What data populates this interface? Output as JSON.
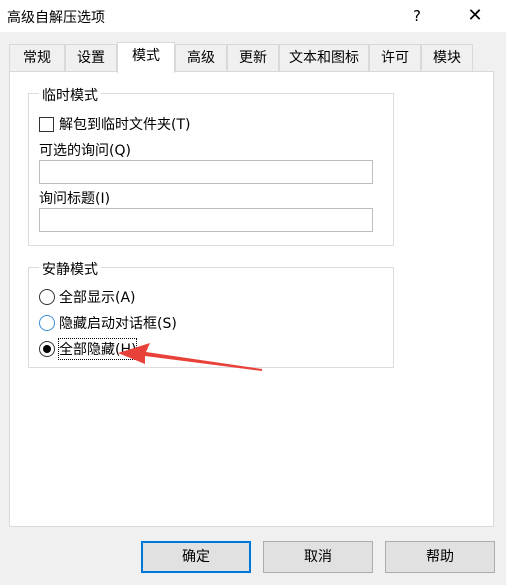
{
  "window": {
    "title": "高级自解压选项",
    "help_label": "?",
    "close_label": "✕"
  },
  "tabs": [
    {
      "label": "常规"
    },
    {
      "label": "设置"
    },
    {
      "label": "模式"
    },
    {
      "label": "高级"
    },
    {
      "label": "更新"
    },
    {
      "label": "文本和图标"
    },
    {
      "label": "许可"
    },
    {
      "label": "模块"
    }
  ],
  "temp_mode": {
    "title": "临时模式",
    "unpack_checkbox": {
      "label": "解包到临时文件夹(T)",
      "checked": false
    },
    "optional_query_label": "可选的询问(Q)",
    "optional_query_value": "",
    "query_title_label": "询问标题(I)",
    "query_title_value": ""
  },
  "silent_mode": {
    "title": "安静模式",
    "options": [
      {
        "label": "全部显示(A)",
        "checked": false
      },
      {
        "label": "隐藏启动对话框(S)",
        "checked": false
      },
      {
        "label": "全部隐藏(H)",
        "checked": true
      }
    ]
  },
  "buttons": {
    "ok": "确定",
    "cancel": "取消",
    "help": "帮助"
  },
  "colors": {
    "annotation_arrow": "#e8413a",
    "default_button_border": "#0078d7"
  }
}
